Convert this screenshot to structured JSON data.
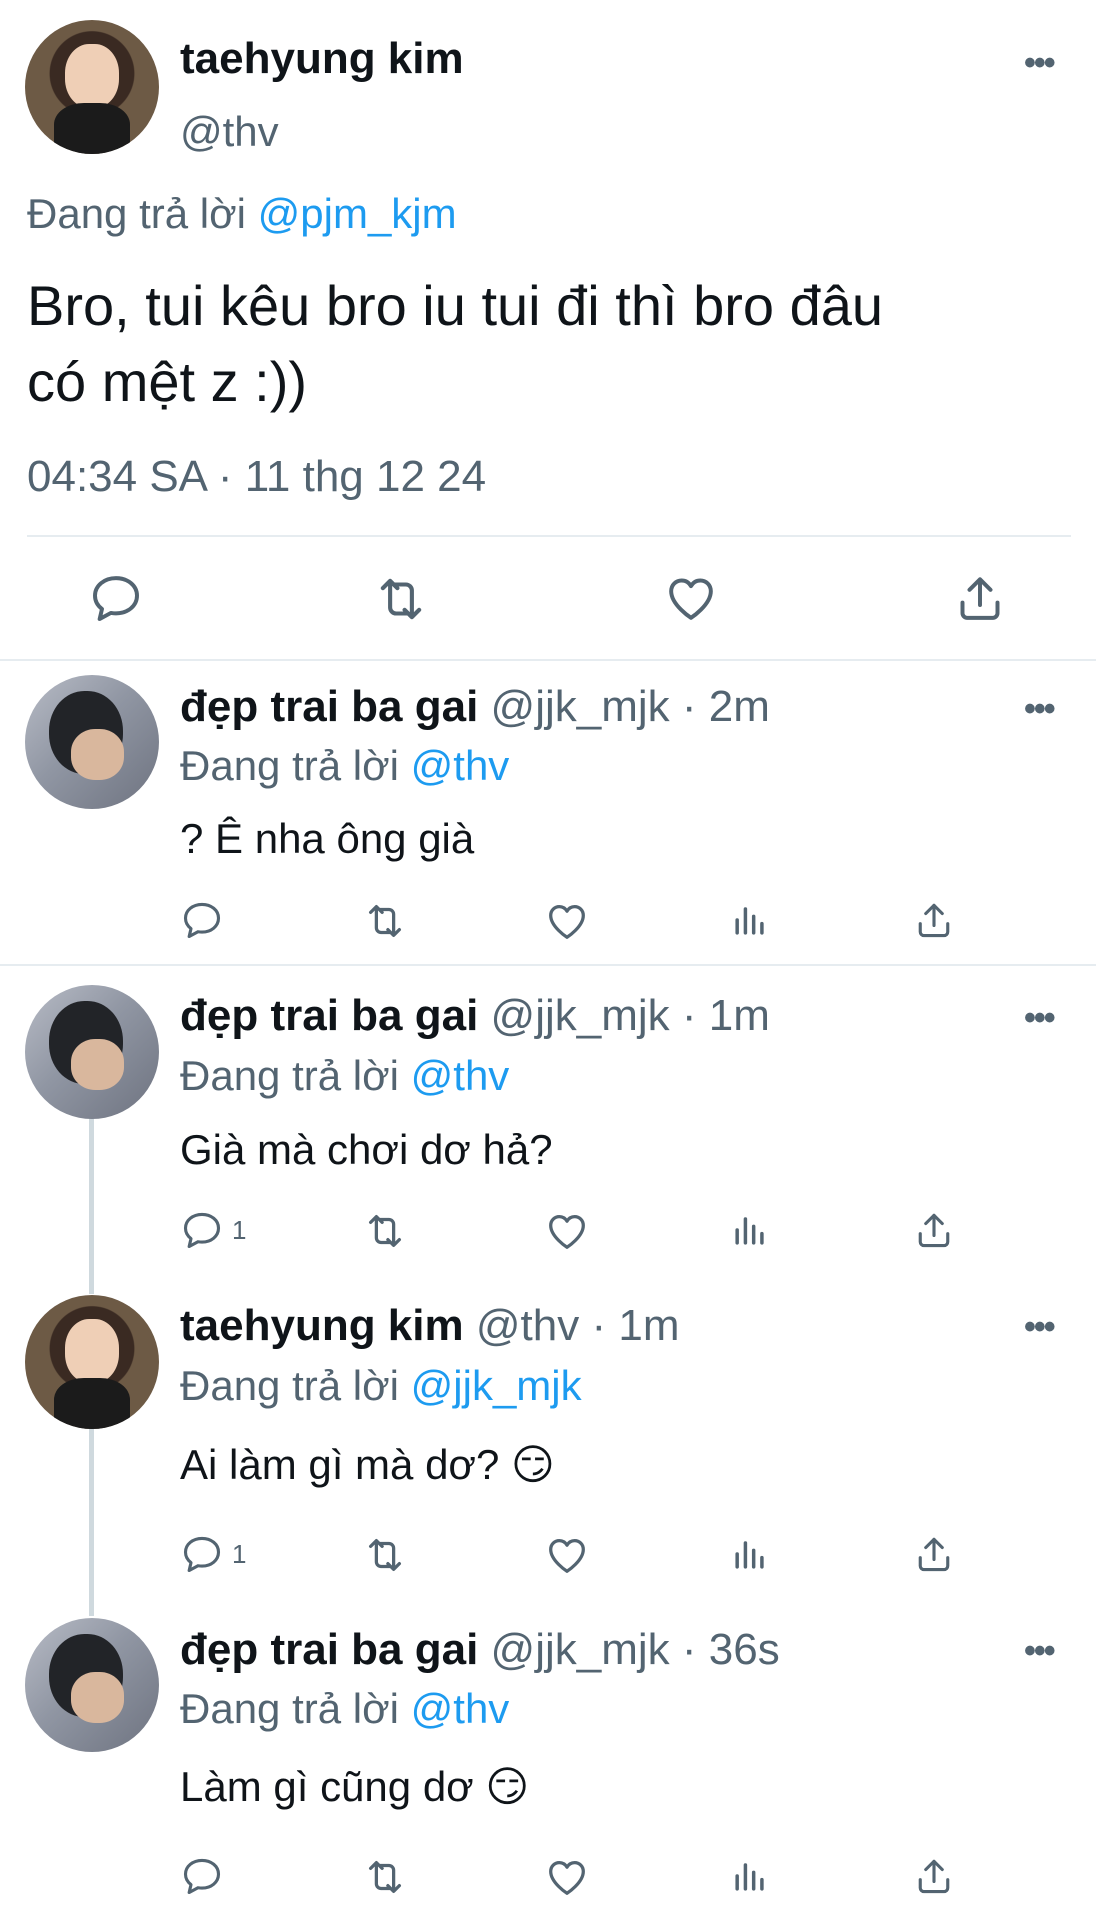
{
  "main_tweet": {
    "name": "taehyung kim",
    "handle": "@thv",
    "replying_prefix": "Đang trả lời",
    "replying_to": "@pjm_kjm",
    "text_line1": "Bro, tui kêu bro iu tui đi thì bro đâu",
    "text_line2": "có mệt z :))",
    "timestamp": "04:34 SA · 11 thg 12 24"
  },
  "replies": [
    {
      "name": "đẹp trai ba gai",
      "handle": "@jjk_mjk",
      "time": "· 2m",
      "replying_prefix": "Đang trả lời",
      "replying_to": "@thv",
      "text": "? Ê nha ông già",
      "reply_count": ""
    },
    {
      "name": "đẹp trai ba gai",
      "handle": "@jjk_mjk",
      "time": "· 1m",
      "replying_prefix": "Đang trả lời",
      "replying_to": "@thv",
      "text": "Già mà chơi dơ hả?",
      "reply_count": "1"
    },
    {
      "name": "taehyung kim",
      "handle": "@thv",
      "time": "· 1m",
      "replying_prefix": "Đang trả lời",
      "replying_to": "@jjk_mjk",
      "text": "Ai làm gì mà dơ? 😏",
      "reply_count": "1"
    },
    {
      "name": "đẹp trai ba gai",
      "handle": "@jjk_mjk",
      "time": "· 36s",
      "replying_prefix": "Đang trả lời",
      "replying_to": "@thv",
      "text": "Làm gì cũng dơ 😏",
      "reply_count": ""
    }
  ],
  "more_glyph": "•••",
  "icons": [
    "reply-icon",
    "retweet-icon",
    "like-icon",
    "views-icon",
    "share-icon",
    "more-icon"
  ],
  "colors": {
    "link": "#1d9bf0",
    "muted": "#536471",
    "text": "#0f1419",
    "divider": "#e6ecf0"
  }
}
